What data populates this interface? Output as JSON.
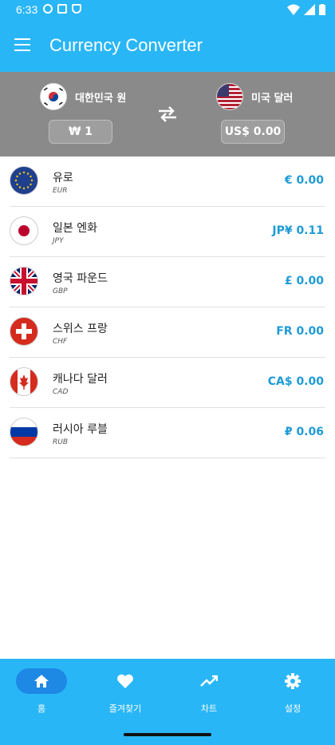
{
  "status_bar": {
    "time": "6:33"
  },
  "app_bar": {
    "title": "Currency Converter"
  },
  "converter": {
    "from": {
      "name": "대한민국 원",
      "value": "₩ 1"
    },
    "to": {
      "name": "미국 달러",
      "value": "US$ 0.00"
    }
  },
  "rates": [
    {
      "name": "유로",
      "code": "EUR",
      "amount": "€ 0.00"
    },
    {
      "name": "일본 엔화",
      "code": "JPY",
      "amount": "JP¥ 0.11"
    },
    {
      "name": "영국 파운드",
      "code": "GBP",
      "amount": "£ 0.00"
    },
    {
      "name": "스위스 프랑",
      "code": "CHF",
      "amount": "FR 0.00"
    },
    {
      "name": "캐나다 달러",
      "code": "CAD",
      "amount": "CA$ 0.00"
    },
    {
      "name": "러시아 루블",
      "code": "RUB",
      "amount": "₽ 0.06"
    }
  ],
  "nav": {
    "items": [
      {
        "label": "홈",
        "icon": "home-icon"
      },
      {
        "label": "즐겨찾기",
        "icon": "heart-icon"
      },
      {
        "label": "차트",
        "icon": "trending-up-icon"
      },
      {
        "label": "설정",
        "icon": "gear-icon"
      }
    ]
  }
}
